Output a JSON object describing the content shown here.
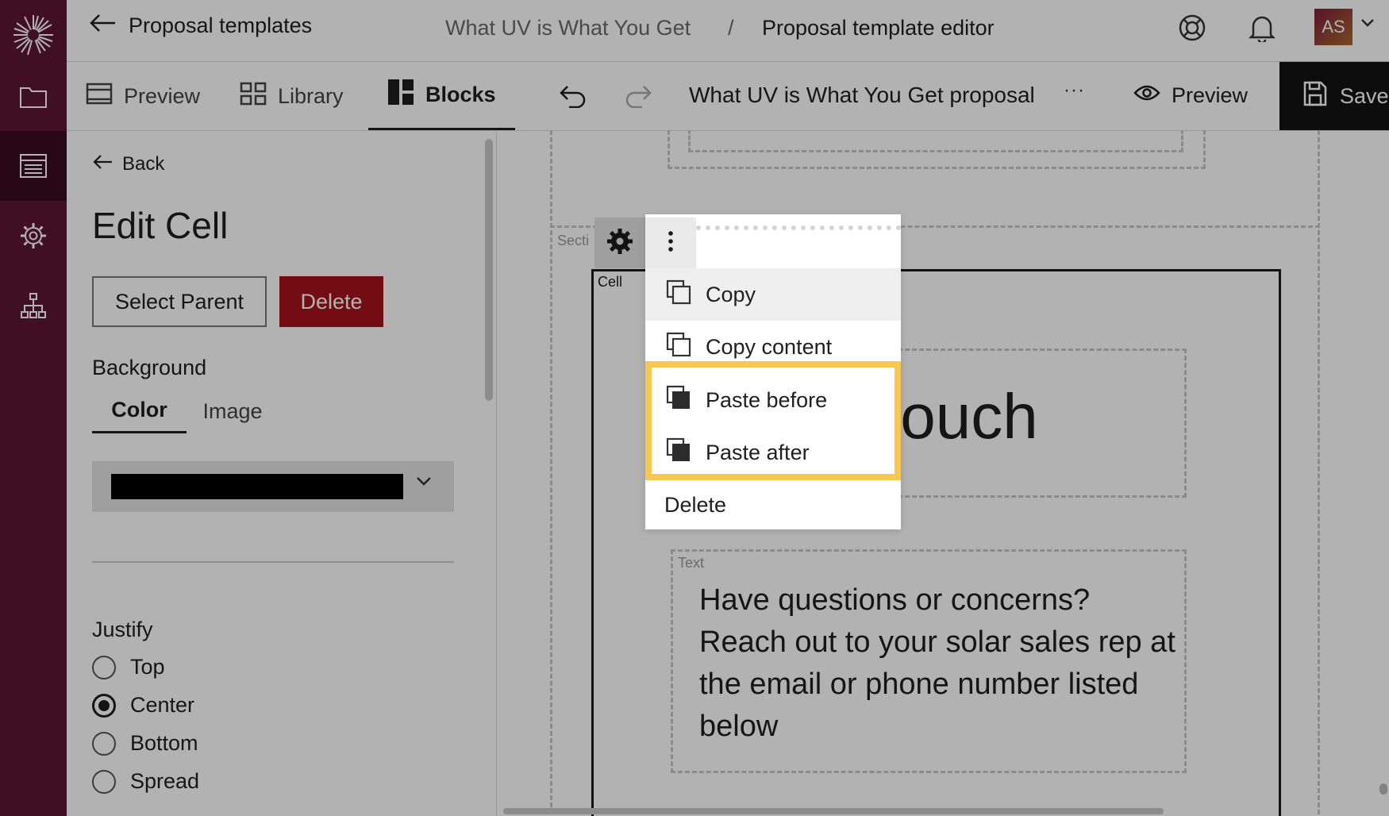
{
  "rail": {
    "items": [
      {
        "name": "logo",
        "icon": "logo-icon"
      },
      {
        "name": "folder",
        "icon": "folder-icon"
      },
      {
        "name": "templates",
        "icon": "list-icon"
      },
      {
        "name": "settings",
        "icon": "gear-icon"
      },
      {
        "name": "org-chart",
        "icon": "hierarchy-icon"
      }
    ]
  },
  "header": {
    "back_label": "Proposal templates",
    "breadcrumb_project": "What UV is What You Get",
    "breadcrumb_separator": "/",
    "breadcrumb_current": "Proposal template editor",
    "avatar_initials": "AS"
  },
  "toolbar": {
    "tabs": [
      {
        "label": "Preview"
      },
      {
        "label": "Library"
      },
      {
        "label": "Blocks"
      }
    ],
    "document_title": "What UV is What You Get proposal",
    "more_label": "···",
    "preview_label": "Preview",
    "save_label": "Save"
  },
  "panel": {
    "back_label": "Back",
    "title": "Edit Cell",
    "select_parent_label": "Select Parent",
    "delete_label": "Delete",
    "background_label": "Background",
    "background_tabs": [
      {
        "label": "Color"
      },
      {
        "label": "Image"
      }
    ],
    "background_color": "#000000",
    "justify_label": "Justify",
    "justify_options": [
      {
        "label": "Top",
        "checked": false
      },
      {
        "label": "Center",
        "checked": true
      },
      {
        "label": "Bottom",
        "checked": false
      },
      {
        "label": "Spread",
        "checked": false
      }
    ]
  },
  "canvas": {
    "section_label": "Secti",
    "cell_label": "Cell",
    "heading_visible": "touch",
    "text_label": "Text",
    "body_text": "Have questions or concerns? Reach out to your solar sales rep at the email or phone number listed below"
  },
  "context_menu": {
    "items": [
      {
        "label": "Copy",
        "icon": "copy-icon"
      },
      {
        "label": "Copy content",
        "icon": "copy-icon"
      },
      {
        "label": "Paste before",
        "icon": "paste-icon"
      },
      {
        "label": "Paste after",
        "icon": "paste-icon"
      },
      {
        "label": "Delete"
      }
    ]
  },
  "colors": {
    "rail_bg": "#5c1634",
    "delete_red": "#a5141c",
    "highlight_yellow": "#f5c851",
    "save_bg": "#141414"
  }
}
